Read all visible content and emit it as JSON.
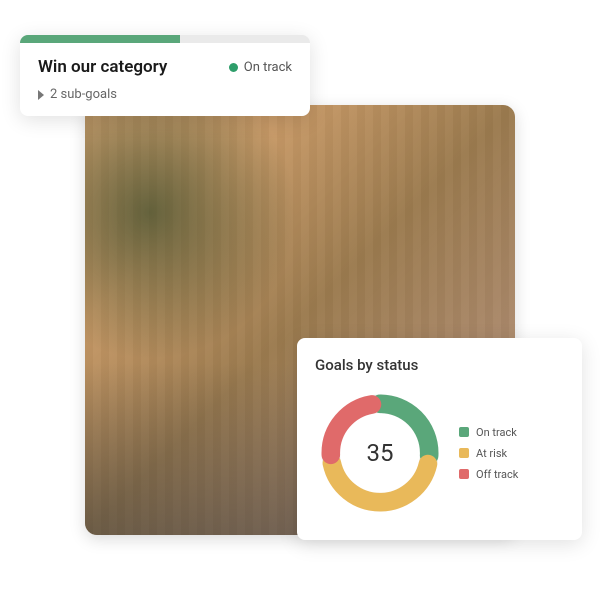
{
  "goal_card": {
    "title": "Win our category",
    "status_label": "On track",
    "status_color": "#2e9e6b",
    "progress_pct": 55,
    "subgoals_label": "2 sub-goals"
  },
  "chart_card": {
    "title": "Goals by status",
    "total": "35"
  },
  "chart_data": {
    "type": "pie",
    "title": "Goals by status",
    "total": 35,
    "series": [
      {
        "name": "On track",
        "value": 10,
        "color": "#5aa77a"
      },
      {
        "name": "At risk",
        "value": 16,
        "color": "#e9b95a"
      },
      {
        "name": "Off track",
        "value": 9,
        "color": "#e06a6a"
      }
    ]
  }
}
